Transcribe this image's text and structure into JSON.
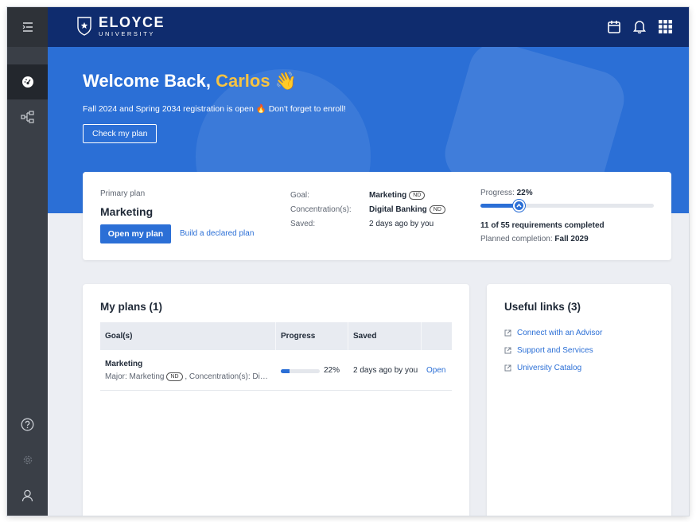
{
  "brand": {
    "name": "ELOYCE",
    "sub": "UNIVERSITY"
  },
  "colors": {
    "primary": "#2b6fd6",
    "navy": "#0f2c6e",
    "sidebar": "#3a3f47",
    "accent": "#f6c343"
  },
  "hero": {
    "greeting": "Welcome Back, ",
    "name": "Carlos",
    "wave": "👋",
    "notice": "Fall 2024 and Spring 2034 registration is open 🔥 Don't forget to enroll!",
    "cta": "Check my plan"
  },
  "primary_plan": {
    "label": "Primary plan",
    "name": "Marketing",
    "open_button": "Open my plan",
    "build_link": "Build a declared plan",
    "goal_label": "Goal:",
    "goal_value": "Marketing",
    "goal_badge": "ND",
    "concentration_label": "Concentration(s):",
    "concentration_value": "Digital Banking",
    "concentration_badge": "ND",
    "saved_label": "Saved:",
    "saved_value": "2 days ago by you",
    "progress_label": "Progress: ",
    "progress_text": "22%",
    "progress": 0.22,
    "requirements": "11 of 55 requirements completed",
    "planned_label": "Planned completion: ",
    "planned_value": "Fall 2029"
  },
  "my_plans": {
    "title": "My plans (1)",
    "columns": [
      "Goal(s)",
      "Progress",
      "Saved"
    ],
    "rows": [
      {
        "goal": "Marketing",
        "detail_prefix": "Major: Marketing",
        "badge": "ND",
        "detail_suffix": ", Concentration(s): Digital Banking",
        "progress": 0.22,
        "progress_text": "22%",
        "saved": "2 days ago by you",
        "action": "Open"
      }
    ]
  },
  "useful_links": {
    "title": "Useful links (3)",
    "items": [
      "Connect with an Advisor",
      "Support and Services",
      "University Catalog"
    ]
  }
}
